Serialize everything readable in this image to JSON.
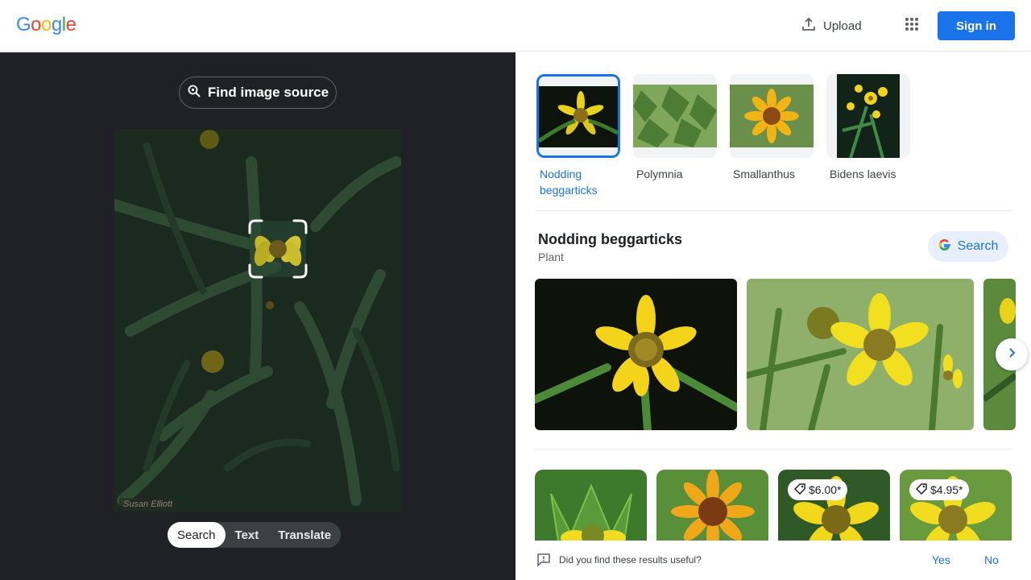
{
  "header": {
    "logo": [
      "G",
      "o",
      "o",
      "g",
      "l",
      "e"
    ],
    "logo_colors": [
      "#4285F4",
      "#EA4335",
      "#FBBC05",
      "#4285F4",
      "#34A853",
      "#EA4335"
    ],
    "upload_label": "Upload",
    "apps_icon": "apps-grid-icon",
    "signin_label": "Sign in"
  },
  "left_panel": {
    "find_source_label": "Find image source",
    "photo_credit": "Susan Elliott",
    "tabs": [
      {
        "label": "Search",
        "active": true
      },
      {
        "label": "Text",
        "active": false
      },
      {
        "label": "Translate",
        "active": false
      }
    ]
  },
  "matches": [
    {
      "label": "Nodding beggarticks",
      "selected": true
    },
    {
      "label": "Polymnia",
      "selected": false
    },
    {
      "label": "Smallanthus",
      "selected": false
    },
    {
      "label": "Bidens laevis",
      "selected": false
    }
  ],
  "entity": {
    "title": "Nodding beggarticks",
    "subtitle": "Plant",
    "search_label": "Search"
  },
  "results": {
    "prices": [
      "$6.00*",
      "$4.95*"
    ]
  },
  "feedback": {
    "question": "Did you find these results useful?",
    "yes": "Yes",
    "no": "No"
  },
  "colors": {
    "accent": "#1a73e8",
    "left_bg": "#202124"
  }
}
